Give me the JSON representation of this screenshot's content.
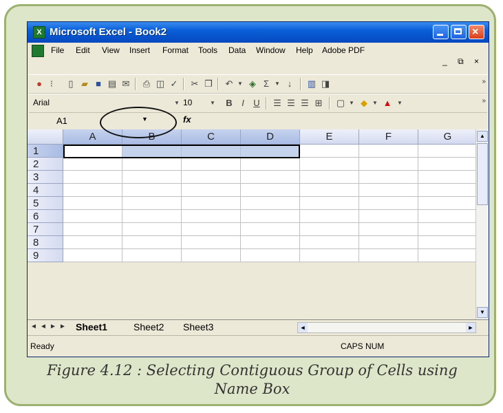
{
  "window": {
    "title": "Microsoft Excel - Book2"
  },
  "menu": [
    "File",
    "Edit",
    "View",
    "Insert",
    "Format",
    "Tools",
    "Data",
    "Window",
    "Help",
    "Adobe PDF"
  ],
  "window_controls": "_ ⧉ ×",
  "toolbar": {
    "font": "Arial",
    "size": "10"
  },
  "formula_bar": {
    "name_box": "A1",
    "fx": "fx"
  },
  "grid": {
    "columns": [
      "A",
      "B",
      "C",
      "D",
      "E",
      "F",
      "G"
    ],
    "rows": [
      "1",
      "2",
      "3",
      "4",
      "5",
      "6",
      "7",
      "8",
      "9"
    ],
    "selection": "A1:D1"
  },
  "sheets": {
    "tabs": [
      "Sheet1",
      "Sheet2",
      "Sheet3"
    ],
    "active": "Sheet1"
  },
  "status": {
    "left": "Ready",
    "right": "CAPS NUM"
  },
  "caption": {
    "line1": "Figure 4.12 : Selecting Contiguous Group of Cells using",
    "line2": "Name Box"
  }
}
